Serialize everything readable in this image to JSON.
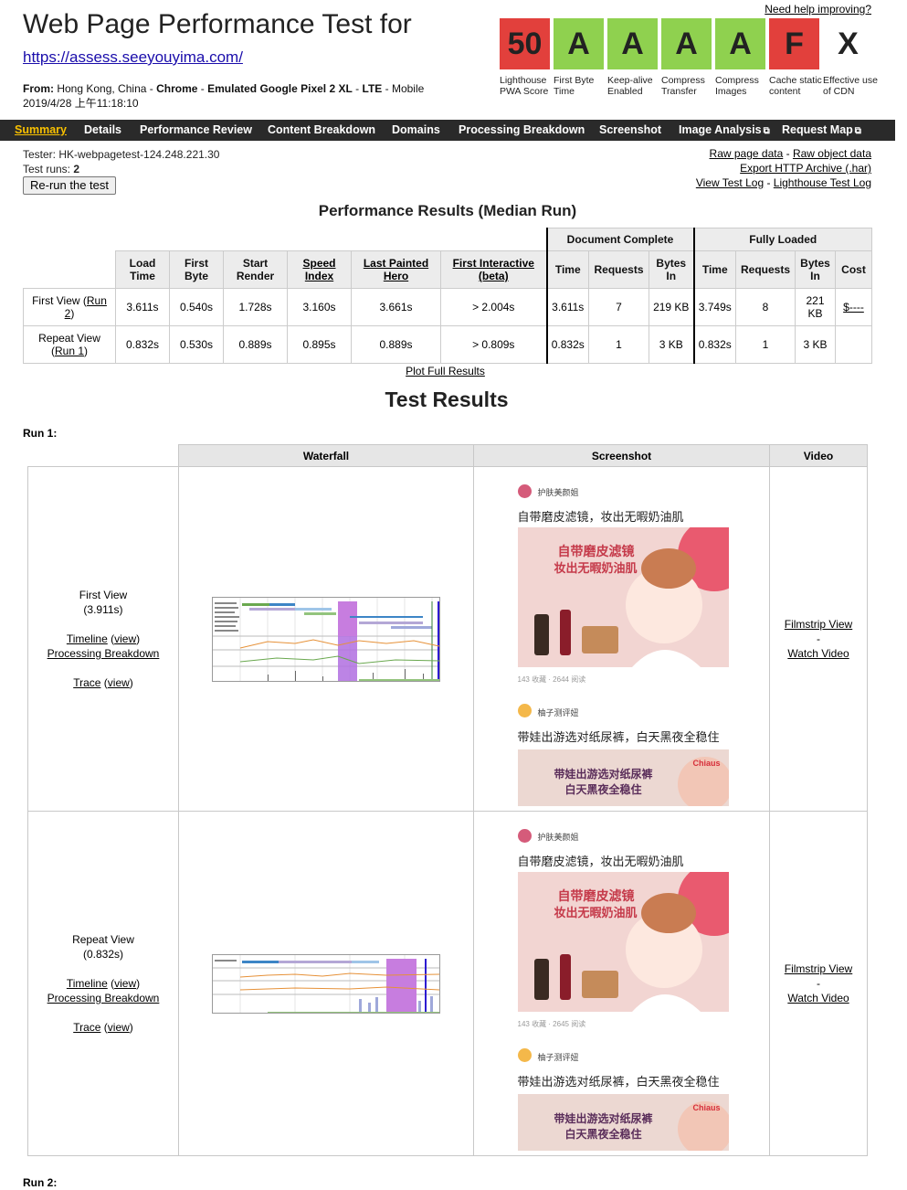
{
  "header": {
    "title": "Web Page Performance Test for",
    "url": "https://assess.seeyouyima.com/",
    "from_label": "From:",
    "location": "Hong Kong, China",
    "browser": "Chrome",
    "device": "Emulated Google Pixel 2 XL",
    "connection": "LTE",
    "platform": "Mobile",
    "datetime": "2019/4/28 上午11:18:10",
    "help_link": "Need help improving?"
  },
  "grades": [
    {
      "grade": "50",
      "label": "Lighthouse PWA Score",
      "color": "#e2403c"
    },
    {
      "grade": "A",
      "label": "First Byte Time",
      "color": "#8fd14f"
    },
    {
      "grade": "A",
      "label": "Keep-alive Enabled",
      "color": "#8fd14f"
    },
    {
      "grade": "A",
      "label": "Compress Transfer",
      "color": "#8fd14f"
    },
    {
      "grade": "A",
      "label": "Compress Images",
      "color": "#8fd14f"
    },
    {
      "grade": "F",
      "label": "Cache static content",
      "color": "#e2403c"
    },
    {
      "grade": "X",
      "label": "Effective use of CDN",
      "color": "#ffffff"
    }
  ],
  "nav": {
    "summary": "Summary",
    "details": "Details",
    "performance_review": "Performance Review",
    "content_breakdown": "Content Breakdown",
    "domains": "Domains",
    "processing_breakdown": "Processing Breakdown",
    "screenshot": "Screenshot",
    "image_analysis": "Image Analysis",
    "request_map": "Request Map"
  },
  "tester": {
    "tester_line": "Tester: HK-webpagetest-124.248.221.30",
    "runs_label": "Test runs:",
    "runs_value": "2",
    "rerun_button": "Re-run the test"
  },
  "links": {
    "raw_page": "Raw page data",
    "raw_object": "Raw object data",
    "export_har": "Export HTTP Archive (.har)",
    "view_test_log": "View Test Log",
    "lighthouse_log": "Lighthouse Test Log",
    "plot_full": "Plot Full Results"
  },
  "performance": {
    "title": "Performance Results (Median Run)",
    "group_doc": "Document Complete",
    "group_full": "Fully Loaded",
    "headers": {
      "load_time": "Load Time",
      "first_byte": "First Byte",
      "start_render": "Start Render",
      "speed_index": "Speed Index",
      "last_painted_hero": "Last Painted Hero",
      "first_interactive": "First Interactive (beta)",
      "time": "Time",
      "requests": "Requests",
      "bytes_in": "Bytes In",
      "cost": "Cost"
    },
    "rows": [
      {
        "label": "First View (",
        "run_link": "Run 2",
        "label_end": ")",
        "load_time": "3.611s",
        "first_byte": "0.540s",
        "start_render": "1.728s",
        "speed_index": "3.160s",
        "last_painted_hero": "3.661s",
        "first_interactive": "> 2.004s",
        "doc_time": "3.611s",
        "doc_requests": "7",
        "doc_bytes": "219 KB",
        "full_time": "3.749s",
        "full_requests": "8",
        "full_bytes": "221 KB",
        "cost": "$----"
      },
      {
        "label": "Repeat View (",
        "run_link": "Run 1",
        "label_end": ")",
        "load_time": "0.832s",
        "first_byte": "0.530s",
        "start_render": "0.889s",
        "speed_index": "0.895s",
        "last_painted_hero": "0.889s",
        "first_interactive": "> 0.809s",
        "doc_time": "0.832s",
        "doc_requests": "1",
        "doc_bytes": "3 KB",
        "full_time": "0.832s",
        "full_requests": "1",
        "full_bytes": "3 KB",
        "cost": ""
      }
    ]
  },
  "results": {
    "title": "Test Results",
    "run1_label": "Run 1:",
    "run2_label": "Run 2:",
    "columns": {
      "waterfall": "Waterfall",
      "screenshot": "Screenshot",
      "video": "Video"
    },
    "views": [
      {
        "name": "First View",
        "time": "(3.911s)",
        "timeline": "Timeline",
        "view": "view",
        "processing": "Processing Breakdown",
        "trace": "Trace",
        "filmstrip": "Filmstrip View",
        "dash": "-",
        "watch": "Watch Video",
        "stats": "143 收藏 · 2644 阅读"
      },
      {
        "name": "Repeat View",
        "time": "(0.832s)",
        "timeline": "Timeline",
        "view": "view",
        "processing": "Processing Breakdown",
        "trace": "Trace",
        "filmstrip": "Filmstrip View",
        "dash": "-",
        "watch": "Watch Video",
        "stats": "143 收藏 · 2645 阅读"
      }
    ],
    "screenshot_content": {
      "author1": "护肤美颜姐",
      "caption1": "自带磨皮滤镜，妆出无暇奶油肌",
      "banner1_line1": "自带磨皮滤镜",
      "banner1_line2": "妆出无暇奶油肌",
      "author2": "柚子测评妞",
      "caption2": "带娃出游选对纸尿裤，白天黑夜全稳住",
      "banner2_line1": "带娃出游选对纸尿裤",
      "banner2_line2": "白天黑夜全稳住",
      "brand": "Chiaus"
    }
  },
  "colors": {
    "grade_red": "#e2403c",
    "grade_green": "#8fd14f",
    "nav_bg": "#2a2a2a",
    "nav_active": "#f8c000",
    "url_blue": "#1a0dab"
  }
}
